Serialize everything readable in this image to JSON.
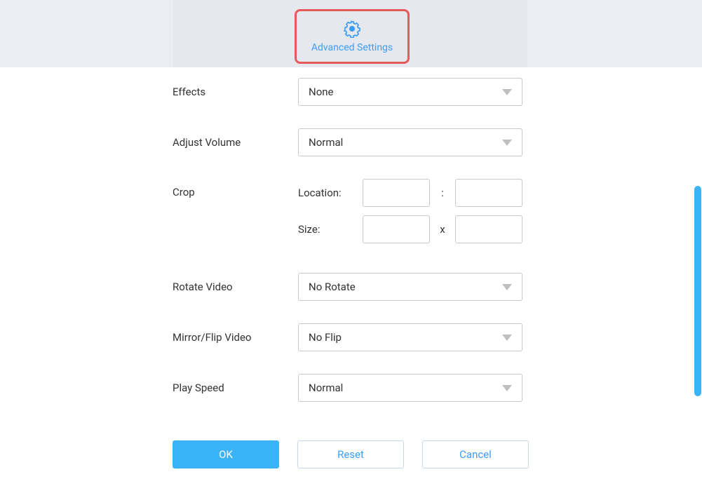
{
  "header": {
    "tab_label": "Advanced Settings",
    "icon_name": "gear-icon"
  },
  "form": {
    "effects": {
      "label": "Effects",
      "value": "None"
    },
    "adjust_volume": {
      "label": "Adjust Volume",
      "value": "Normal"
    },
    "crop": {
      "label": "Crop",
      "location_label": "Location:",
      "size_label": "Size:",
      "separator_location": ":",
      "separator_size": "x",
      "location_x": "",
      "location_y": "",
      "size_w": "",
      "size_h": ""
    },
    "rotate_video": {
      "label": "Rotate Video",
      "value": "No Rotate"
    },
    "mirror_flip": {
      "label": "Mirror/Flip Video",
      "value": "No Flip"
    },
    "play_speed": {
      "label": "Play Speed",
      "value": "Normal"
    }
  },
  "buttons": {
    "ok": "OK",
    "reset": "Reset",
    "cancel": "Cancel"
  },
  "colors": {
    "accent": "#3b9df8",
    "primary_button": "#3bb3f9",
    "highlight_border": "#e85a5a"
  }
}
